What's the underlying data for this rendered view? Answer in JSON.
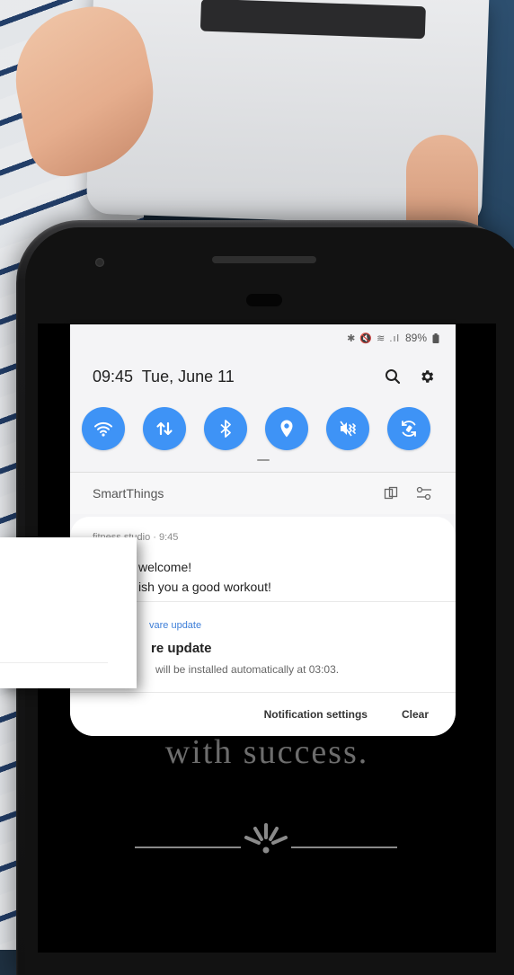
{
  "status_bar": {
    "icons": "✱ 🔇 ≋ .ıl",
    "battery": "89%"
  },
  "header": {
    "time": "09:45",
    "date": "Tue, June 11"
  },
  "quick_settings": [
    {
      "name": "wifi",
      "icon": "wifi-icon"
    },
    {
      "name": "data-transfer",
      "icon": "up-down-arrows-icon"
    },
    {
      "name": "bluetooth",
      "icon": "bluetooth-icon"
    },
    {
      "name": "location",
      "icon": "location-pin-icon"
    },
    {
      "name": "sound",
      "icon": "mute-vibrate-icon"
    },
    {
      "name": "auto-rotate",
      "icon": "rotate-icon"
    }
  ],
  "smartthings": {
    "label": "SmartThings"
  },
  "notifications": [
    {
      "app": "fitness studio · 9:45",
      "line1": "welcome!",
      "line2": "ish you a good workout!"
    },
    {
      "app": "vare update",
      "title": "re update",
      "body": "will be installed automatically at 03:03."
    }
  ],
  "actions": {
    "settings": "Notification settings",
    "clear": "Clear"
  },
  "screen_text": "with success.",
  "colors": {
    "accent_blue": "#3e93f6",
    "link_blue": "#3d7ed8",
    "panel_bg": "#f4f4f6"
  }
}
